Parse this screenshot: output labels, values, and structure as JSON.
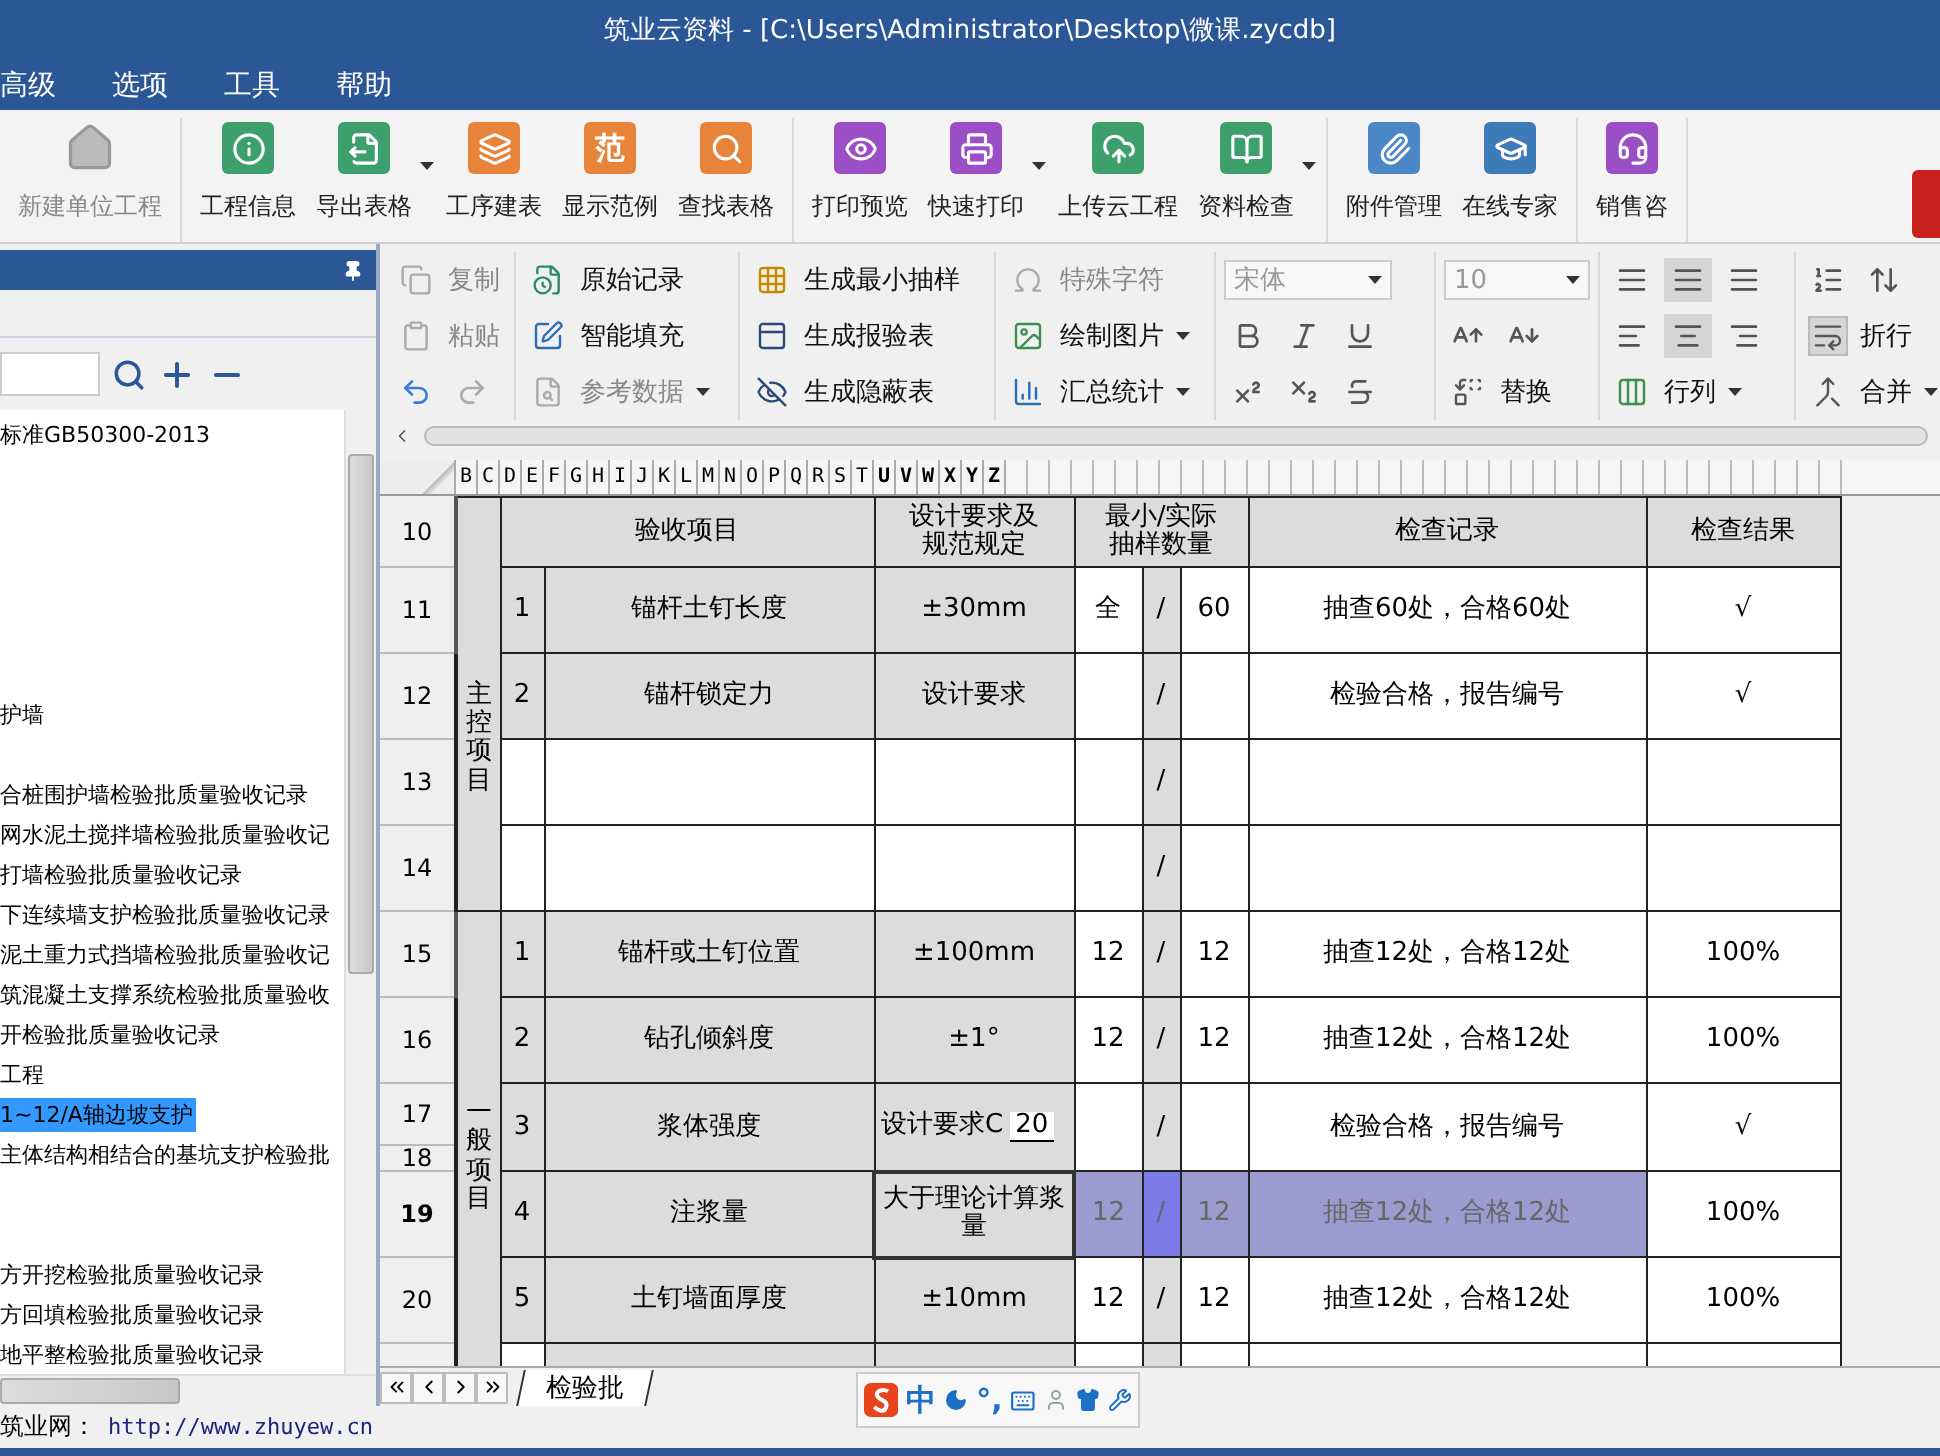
{
  "window": {
    "title": "筑业云资料 - [C:\\Users\\Administrator\\Desktop\\微课.zycdb]"
  },
  "menu": [
    "高级",
    "选项",
    "工具",
    "帮助"
  ],
  "toolbar": {
    "groups": [
      {
        "buttons": [
          {
            "label": "新建单位工程",
            "disabled": true,
            "has_menu": false
          }
        ]
      },
      {
        "buttons": [
          {
            "label": "工程信息",
            "disabled": false,
            "has_menu": false
          },
          {
            "label": "导出表格",
            "disabled": false,
            "has_menu": true
          },
          {
            "label": "工序建表",
            "disabled": false,
            "has_menu": false
          },
          {
            "label": "显示范例",
            "disabled": false,
            "has_menu": false,
            "icon_text": "范"
          },
          {
            "label": "查找表格",
            "disabled": false,
            "has_menu": false
          }
        ]
      },
      {
        "buttons": [
          {
            "label": "打印预览",
            "disabled": false,
            "has_menu": false
          },
          {
            "label": "快速打印",
            "disabled": false,
            "has_menu": true
          },
          {
            "label": "上传云工程",
            "disabled": false,
            "has_menu": false
          },
          {
            "label": "资料检查",
            "disabled": false,
            "has_menu": true
          }
        ]
      },
      {
        "buttons": [
          {
            "label": "附件管理",
            "disabled": false,
            "has_menu": false
          },
          {
            "label": "在线专家",
            "disabled": false,
            "has_menu": false
          }
        ]
      },
      {
        "buttons": [
          {
            "label": "销售咨",
            "disabled": false,
            "has_menu": false
          }
        ]
      }
    ]
  },
  "ribbon": {
    "groups": [
      {
        "rows": [
          [
            {
              "kind": "command",
              "label": "复制",
              "disabled": true
            }
          ],
          [
            {
              "kind": "command",
              "label": "粘贴",
              "disabled": true
            }
          ],
          [
            {
              "kind": "icon",
              "disabled": false
            },
            {
              "kind": "icon",
              "disabled": true
            }
          ]
        ]
      },
      {
        "rows": [
          [
            {
              "kind": "command",
              "label": "原始记录",
              "disabled": false
            }
          ],
          [
            {
              "kind": "command",
              "label": "智能填充",
              "disabled": false
            }
          ],
          [
            {
              "kind": "command",
              "label": "参考数据",
              "disabled": true,
              "has_menu": true
            }
          ]
        ]
      },
      {
        "rows": [
          [
            {
              "kind": "command",
              "label": "生成最小抽样",
              "disabled": false
            }
          ],
          [
            {
              "kind": "command",
              "label": "生成报验表",
              "disabled": false
            }
          ],
          [
            {
              "kind": "command",
              "label": "生成隐蔽表",
              "disabled": false
            }
          ]
        ]
      },
      {
        "rows": [
          [
            {
              "kind": "command",
              "label": "特殊字符",
              "disabled": true
            }
          ],
          [
            {
              "kind": "command",
              "label": "绘制图片",
              "disabled": false,
              "has_menu": true
            }
          ],
          [
            {
              "kind": "command",
              "label": "汇总统计",
              "disabled": false,
              "has_menu": true
            }
          ]
        ]
      },
      {
        "rows": [
          [
            {
              "kind": "select",
              "value": "宋体",
              "disabled": true
            }
          ],
          [
            {
              "kind": "icon",
              "disabled": false
            },
            {
              "kind": "icon",
              "disabled": false
            },
            {
              "kind": "icon",
              "disabled": false
            }
          ],
          [
            {
              "kind": "icon",
              "disabled": false
            },
            {
              "kind": "icon",
              "disabled": false
            },
            {
              "kind": "icon",
              "disabled": false
            }
          ]
        ]
      },
      {
        "rows": [
          [
            {
              "kind": "select",
              "value": "10",
              "disabled": true
            }
          ],
          [
            {
              "kind": "icon",
              "disabled": false
            },
            {
              "kind": "icon",
              "disabled": false
            }
          ],
          [
            {
              "kind": "command",
              "label": "替换",
              "disabled": false
            }
          ]
        ]
      },
      {
        "rows": [
          [
            {
              "kind": "icon",
              "disabled": false,
              "selected": false
            },
            {
              "kind": "icon",
              "disabled": false,
              "selected": true
            },
            {
              "kind": "icon",
              "disabled": false,
              "selected": false
            }
          ],
          [
            {
              "kind": "icon",
              "disabled": false,
              "selected": false
            },
            {
              "kind": "icon",
              "disabled": false,
              "selected": true
            },
            {
              "kind": "icon",
              "disabled": false,
              "selected": false
            }
          ],
          [
            {
              "kind": "command",
              "label": "行列",
              "disabled": false,
              "has_menu": true
            }
          ]
        ]
      },
      {
        "rows": [
          [
            {
              "kind": "icon",
              "disabled": false
            },
            {
              "kind": "icon",
              "disabled": false
            }
          ],
          [
            {
              "kind": "command",
              "label": "折行",
              "disabled": false,
              "selected": true
            }
          ],
          [
            {
              "kind": "command",
              "label": "合并",
              "disabled": false,
              "has_menu": true
            }
          ]
        ]
      }
    ]
  },
  "tree": {
    "items": [
      {
        "kind": "label",
        "label": "标准GB50300-2013",
        "selected": false
      },
      {
        "kind": "blank"
      },
      {
        "kind": "blank"
      },
      {
        "kind": "blank"
      },
      {
        "kind": "blank"
      },
      {
        "kind": "blank"
      },
      {
        "kind": "blank"
      },
      {
        "kind": "label",
        "label": "护墙",
        "selected": false
      },
      {
        "kind": "blank"
      },
      {
        "kind": "label",
        "label": "合桩围护墙检验批质量验收记录",
        "selected": false
      },
      {
        "kind": "label",
        "label": "网水泥土搅拌墙检验批质量验收记",
        "selected": false
      },
      {
        "kind": "label",
        "label": "打墙检验批质量验收记录",
        "selected": false
      },
      {
        "kind": "label",
        "label": "下连续墙支护检验批质量验收记录",
        "selected": false
      },
      {
        "kind": "label",
        "label": "泥土重力式挡墙检验批质量验收记",
        "selected": false
      },
      {
        "kind": "label",
        "label": "筑混凝土支撑系统检验批质量验收",
        "selected": false
      },
      {
        "kind": "label",
        "label": "开检验批质量验收记录",
        "selected": false
      },
      {
        "kind": "label",
        "label": "工程",
        "selected": false
      },
      {
        "kind": "label",
        "label": "1~12/A轴边坡支护",
        "selected": true
      },
      {
        "kind": "label",
        "label": "主体结构相结合的基坑支护检验批",
        "selected": false
      },
      {
        "kind": "blank"
      },
      {
        "kind": "blank"
      },
      {
        "kind": "label",
        "label": "方开挖检验批质量验收记录",
        "selected": false
      },
      {
        "kind": "label",
        "label": "方回填检验批质量验收记录",
        "selected": false
      },
      {
        "kind": "label",
        "label": "地平整检验批质量验收记录",
        "selected": false
      }
    ]
  },
  "sheet": {
    "column_letters": [
      {
        "label": "B",
        "selected": false
      },
      {
        "label": "C",
        "selected": false
      },
      {
        "label": "D",
        "selected": false
      },
      {
        "label": "E",
        "selected": false
      },
      {
        "label": "F",
        "selected": false
      },
      {
        "label": "G",
        "selected": false
      },
      {
        "label": "H",
        "selected": false
      },
      {
        "label": "I",
        "selected": false
      },
      {
        "label": "J",
        "selected": false
      },
      {
        "label": "K",
        "selected": false
      },
      {
        "label": "L",
        "selected": false
      },
      {
        "label": "M",
        "selected": false
      },
      {
        "label": "N",
        "selected": false
      },
      {
        "label": "O",
        "selected": false
      },
      {
        "label": "P",
        "selected": false
      },
      {
        "label": "Q",
        "selected": false
      },
      {
        "label": "R",
        "selected": false
      },
      {
        "label": "S",
        "selected": false
      },
      {
        "label": "T",
        "selected": false
      },
      {
        "label": "U",
        "selected": true
      },
      {
        "label": "V",
        "selected": true
      },
      {
        "label": "W",
        "selected": true
      },
      {
        "label": "X",
        "selected": true
      },
      {
        "label": "Y",
        "selected": true
      },
      {
        "label": "Z",
        "selected": true
      }
    ],
    "header": {
      "row_number": "10",
      "item": "验收项目",
      "spec": [
        "设计要求及",
        "规范规定"
      ],
      "sampling": [
        "最小/实际",
        "抽样数量"
      ],
      "record": "检查记录",
      "result": "检查结果"
    },
    "sections": [
      {
        "label": "主控项目",
        "rows": [
          {
            "row_numbers": [
              "11"
            ],
            "no": "1",
            "item": "锚杆土钉长度",
            "spec": "±30mm",
            "min": "全",
            "slash": "/",
            "actual": "60",
            "record": "抽查60处，合格60处",
            "result": "√",
            "selected": false
          },
          {
            "row_numbers": [
              "12"
            ],
            "no": "2",
            "item": "锚杆锁定力",
            "spec": "设计要求",
            "slash": "/",
            "record": "检验合格，报告编号",
            "result": "√",
            "selected": false
          },
          {
            "row_numbers": [
              "13"
            ],
            "slash": "/",
            "selected": false
          },
          {
            "row_numbers": [
              "14"
            ],
            "slash": "/",
            "selected": false
          }
        ]
      },
      {
        "label": "一般项目",
        "rows": [
          {
            "row_numbers": [
              "15"
            ],
            "no": "1",
            "item": "锚杆或土钉位置",
            "spec": "±100mm",
            "min": "12",
            "slash": "/",
            "actual": "12",
            "record": "抽查12处，合格12处",
            "result": "100%",
            "selected": false
          },
          {
            "row_numbers": [
              "16"
            ],
            "no": "2",
            "item": "钻孔倾斜度",
            "spec": "±1°",
            "min": "12",
            "slash": "/",
            "actual": "12",
            "record": "抽查12处，合格12处",
            "result": "100%",
            "selected": false
          },
          {
            "row_numbers": [
              "17",
              "18"
            ],
            "no": "3",
            "item": "浆体强度",
            "spec": "设计要求C",
            "spec_value": "20",
            "slash": "/",
            "record": "检验合格，报告编号",
            "result": "√",
            "selected": false
          },
          {
            "row_numbers": [
              "19"
            ],
            "no": "4",
            "item": "注浆量",
            "spec": "大于理论计算浆量",
            "min": "12",
            "slash": "/",
            "actual": "12",
            "record": "抽查12处，合格12处",
            "result": "100%",
            "selected": true
          },
          {
            "row_numbers": [
              "20"
            ],
            "no": "5",
            "item": "土钉墙面厚度",
            "spec": "±10mm",
            "min": "12",
            "slash": "/",
            "actual": "12",
            "record": "抽查12处，合格12处",
            "result": "100%",
            "selected": false
          }
        ]
      }
    ]
  },
  "sheet_tabs": [
    {
      "label": "检验批",
      "selected": true
    }
  ],
  "ime": {
    "mode": "中",
    "punctuation": "°,"
  },
  "status_bar": {
    "site_label": "筑业网：",
    "link": "http://www.zhuyew.cn"
  }
}
